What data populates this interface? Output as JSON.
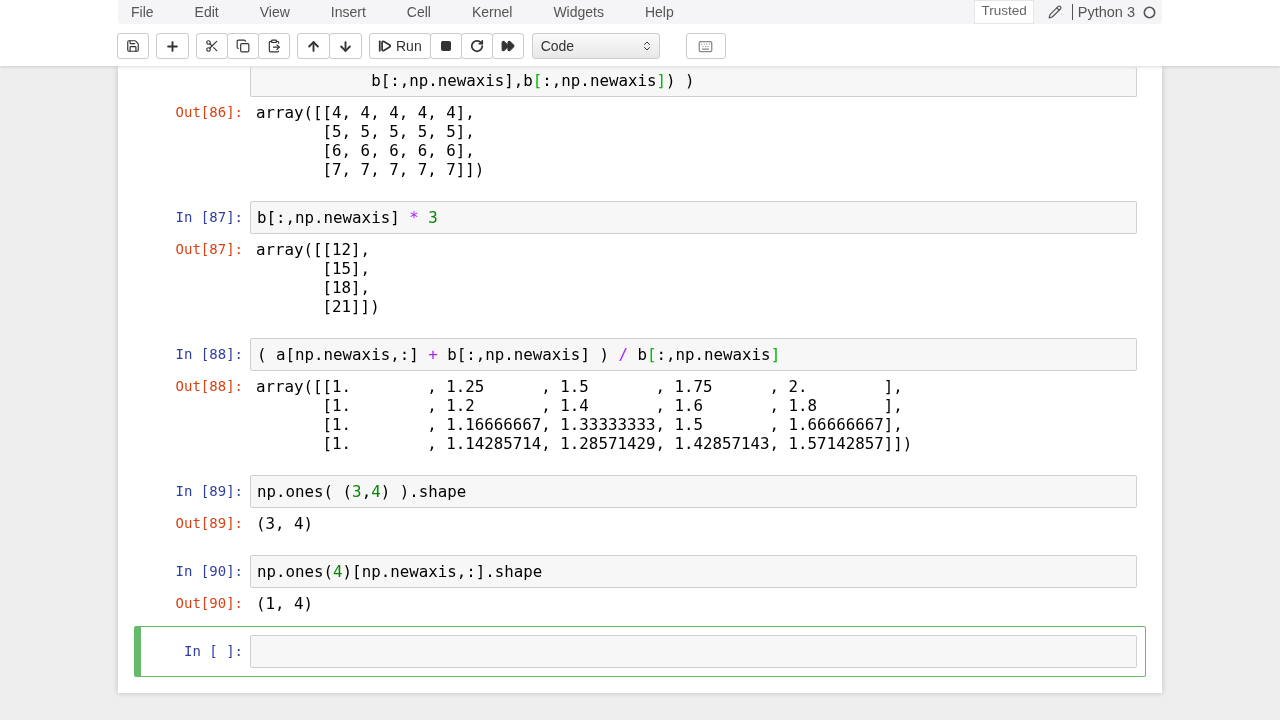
{
  "menu": [
    "File",
    "Edit",
    "View",
    "Insert",
    "Cell",
    "Kernel",
    "Widgets",
    "Help"
  ],
  "trusted": "Trusted",
  "kernel": {
    "name": "Python 3",
    "busy": false
  },
  "toolbar": {
    "run_label": "Run",
    "cell_type": "Code"
  },
  "cells": [
    {
      "selected": false,
      "input": [
        [
          {
            "text": "            b[:,np.newaxis],b",
            "kind": "plain"
          },
          {
            "text": "[",
            "kind": "match"
          },
          {
            "text": ":,np.newaxis",
            "kind": "plain"
          },
          {
            "text": "]",
            "kind": "match"
          },
          {
            "text": ") )",
            "kind": "plain"
          }
        ]
      ],
      "output_prompt": "Out[86]:",
      "output": [
        "array([[4, 4, 4, 4, 4],",
        "       [5, 5, 5, 5, 5],",
        "       [6, 6, 6, 6, 6],",
        "       [7, 7, 7, 7, 7]])"
      ]
    },
    {
      "prompt": "In [87]:",
      "selected": false,
      "input": [
        [
          {
            "text": "b[:,np.newaxis] ",
            "kind": "plain"
          },
          {
            "text": "* ",
            "kind": "op"
          },
          {
            "text": "3",
            "kind": "num"
          }
        ]
      ],
      "output_prompt": "Out[87]:",
      "output": [
        "array([[12],",
        "       [15],",
        "       [18],",
        "       [21]])"
      ]
    },
    {
      "prompt": "In [88]:",
      "selected": false,
      "input": [
        [
          {
            "text": "( a[np.newaxis,:] ",
            "kind": "plain"
          },
          {
            "text": "+",
            "kind": "op"
          },
          {
            "text": " b[:,np.newaxis] ) ",
            "kind": "plain"
          },
          {
            "text": "/",
            "kind": "op"
          },
          {
            "text": " b",
            "kind": "plain"
          },
          {
            "text": "[",
            "kind": "match"
          },
          {
            "text": ":,np.newaxis",
            "kind": "plain"
          },
          {
            "text": "]",
            "kind": "match"
          }
        ]
      ],
      "output_prompt": "Out[88]:",
      "output": [
        "array([[1.        , 1.25      , 1.5       , 1.75      , 2.        ],",
        "       [1.        , 1.2       , 1.4       , 1.6       , 1.8       ],",
        "       [1.        , 1.16666667, 1.33333333, 1.5       , 1.66666667],",
        "       [1.        , 1.14285714, 1.28571429, 1.42857143, 1.57142857]])"
      ]
    },
    {
      "prompt": "In [89]:",
      "selected": false,
      "input": [
        [
          {
            "text": "np.ones( (",
            "kind": "plain"
          },
          {
            "text": "3",
            "kind": "num"
          },
          {
            "text": ",",
            "kind": "plain"
          },
          {
            "text": "4",
            "kind": "num"
          },
          {
            "text": ") ).shape",
            "kind": "plain"
          }
        ]
      ],
      "output_prompt": "Out[89]:",
      "output": [
        "(3, 4)"
      ]
    },
    {
      "prompt": "In [90]:",
      "selected": false,
      "input": [
        [
          {
            "text": "np.ones(",
            "kind": "plain"
          },
          {
            "text": "4",
            "kind": "num"
          },
          {
            "text": ")[np.newaxis,:].shape",
            "kind": "plain"
          }
        ]
      ],
      "output_prompt": "Out[90]:",
      "output": [
        "(1, 4)"
      ]
    },
    {
      "prompt": "In [ ]:",
      "selected": true
    }
  ]
}
